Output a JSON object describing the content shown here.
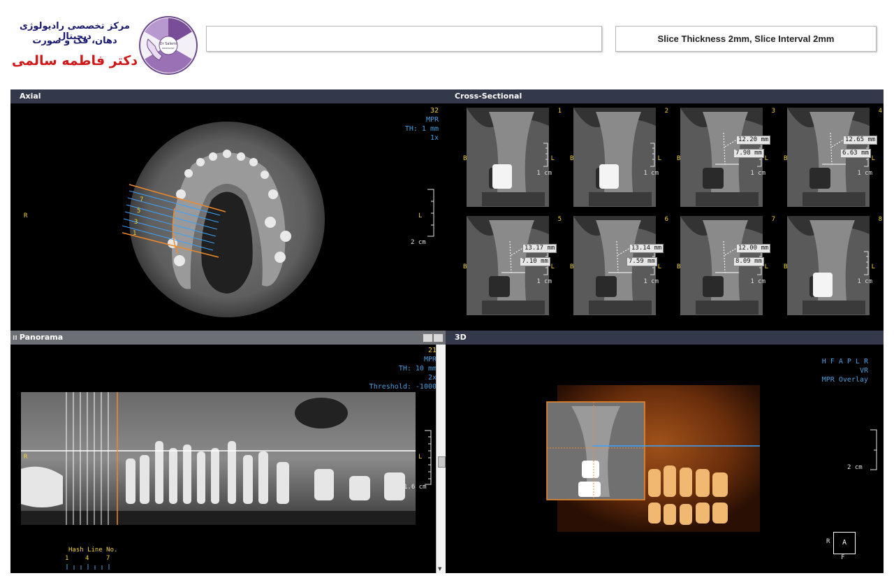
{
  "header": {
    "center_line1": "مرکز تخصصی رادیولوژی دیجیتال",
    "center_line2": "دهان، فک و صورت",
    "doctor_name": "دکتر فاطمه سالمی",
    "logo_text": "Dr Salemi",
    "empty_box": "",
    "slice_info": "Slice Thickness 2mm, Slice Interval 2mm"
  },
  "axial": {
    "title": "Axial",
    "slice_no": "32",
    "mode": "MPR",
    "thickness": "TH: 1 mm",
    "zoom": "1x",
    "left_marker": "R",
    "right_marker": "L",
    "scale": "2 cm",
    "hash_labels": [
      "7",
      "5",
      "3",
      "1"
    ]
  },
  "cross_sectional": {
    "title": "Cross-Sectional",
    "side_b": "B",
    "side_l": "L",
    "scale": "1 cm",
    "slices": [
      {
        "num": "1",
        "m1": "",
        "m2": ""
      },
      {
        "num": "2",
        "m1": "",
        "m2": ""
      },
      {
        "num": "3",
        "m1": "12.20 mm",
        "m2": "7.98 mm"
      },
      {
        "num": "4",
        "m1": "12.65 mm",
        "m2": "6.63 mm"
      },
      {
        "num": "5",
        "m1": "13.17 mm",
        "m2": "7.10 mm"
      },
      {
        "num": "6",
        "m1": "13.14 mm",
        "m2": "7.59 mm"
      },
      {
        "num": "7",
        "m1": "12.00 mm",
        "m2": "8.09 mm"
      },
      {
        "num": "8",
        "m1": "",
        "m2": ""
      }
    ]
  },
  "panorama": {
    "title": "Panorama",
    "slice_no": "21",
    "mode": "MPR",
    "thickness": "TH: 10 mm",
    "zoom": "2x",
    "threshold": "Threshold: -1000",
    "left_marker": "R",
    "right_marker": "L",
    "scale": "1.6 cm",
    "hash_title": "Hash Line No.",
    "hash_nums": [
      "1",
      "4",
      "7"
    ]
  },
  "view3d": {
    "title": "3D",
    "orient": "H F A P L R",
    "mode": "VR",
    "overlay": "MPR Overlay",
    "scale": "2 cm",
    "cube_left": "R",
    "cube_face": "A",
    "cube_bottom": "F"
  }
}
